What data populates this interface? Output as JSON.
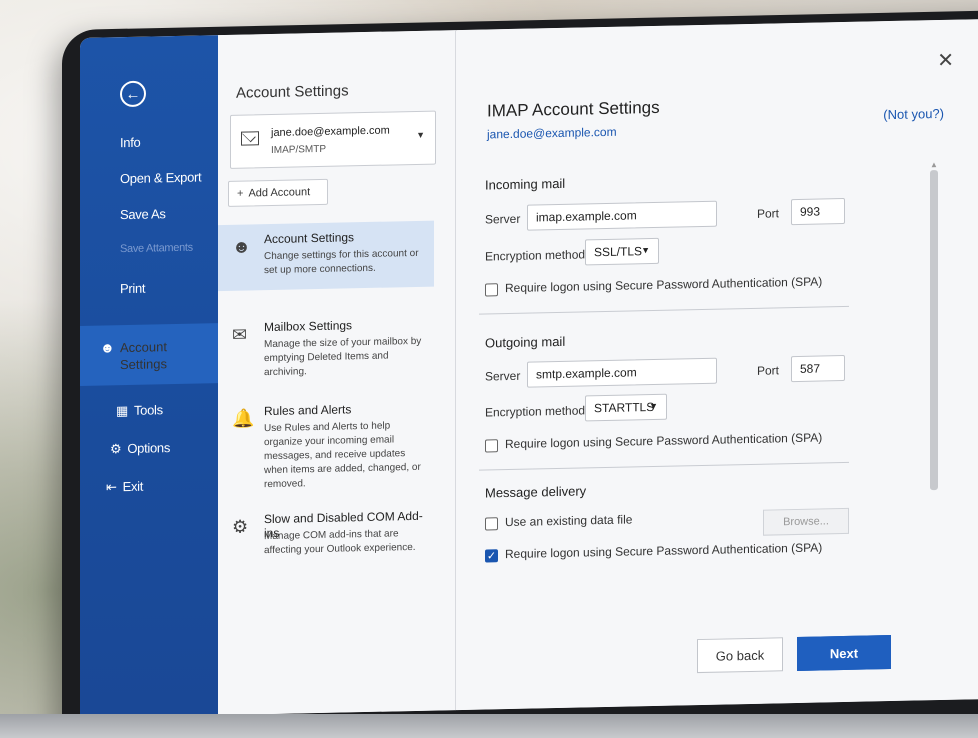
{
  "nav": {
    "back_icon": "back-arrow-icon",
    "items": [
      {
        "label": "Info"
      },
      {
        "label": "Open & Export"
      },
      {
        "label": "Save As"
      },
      {
        "label": "Save Attaments"
      },
      {
        "label": "Print"
      },
      {
        "label": "Account Settings"
      },
      {
        "label": "Tools"
      },
      {
        "label": "Options"
      },
      {
        "label": "Exit"
      }
    ]
  },
  "middle": {
    "title": "Account Settings",
    "account": {
      "email": "jane.doe@example.com",
      "type": "IMAP/SMTP"
    },
    "add_account_label": "Add Account",
    "options": [
      {
        "title": "Account Settings",
        "desc": "Change settings for this account or set up more connections."
      },
      {
        "title": "Mailbox Settings",
        "desc": "Manage the size of your mailbox by emptying Deleted Items and archiving."
      },
      {
        "title": "Rules and Alerts",
        "desc": "Use Rules and Alerts to help organize your incoming email messages, and receive updates when items are added, changed, or removed."
      },
      {
        "title": "Slow and Disabled COM Add-ins",
        "desc": "Manage COM add-ins that are affecting your Outlook experience."
      }
    ]
  },
  "main": {
    "title": "IMAP Account Settings",
    "email": "jane.doe@example.com",
    "not_you": "(Not you?)",
    "incoming": {
      "heading": "Incoming mail",
      "server_label": "Server",
      "server": "imap.example.com",
      "port_label": "Port",
      "port": "993",
      "encryption_label": "Encryption method",
      "encryption": "SSL/TLS",
      "spa_label": "Require logon using Secure Password Authentication (SPA)",
      "spa_checked": false
    },
    "outgoing": {
      "heading": "Outgoing mail",
      "server_label": "Server",
      "server": "smtp.example.com",
      "port_label": "Port",
      "port": "587",
      "encryption_label": "Encryption method",
      "encryption": "STARTTLS",
      "spa_label": "Require logon using Secure Password Authentication (SPA)",
      "spa_checked": false
    },
    "delivery": {
      "heading": "Message delivery",
      "existing_label": "Use an existing data file",
      "existing_checked": false,
      "browse_label": "Browse...",
      "spa_label": "Require logon using Secure Password Authentication (SPA)",
      "spa_checked": true
    },
    "go_back_label": "Go back",
    "next_label": "Next"
  },
  "colors": {
    "nav_blue": "#1d54a8",
    "accent": "#1f5fbf",
    "link": "#1a56b0",
    "selected_option": "#d6e3f4"
  }
}
